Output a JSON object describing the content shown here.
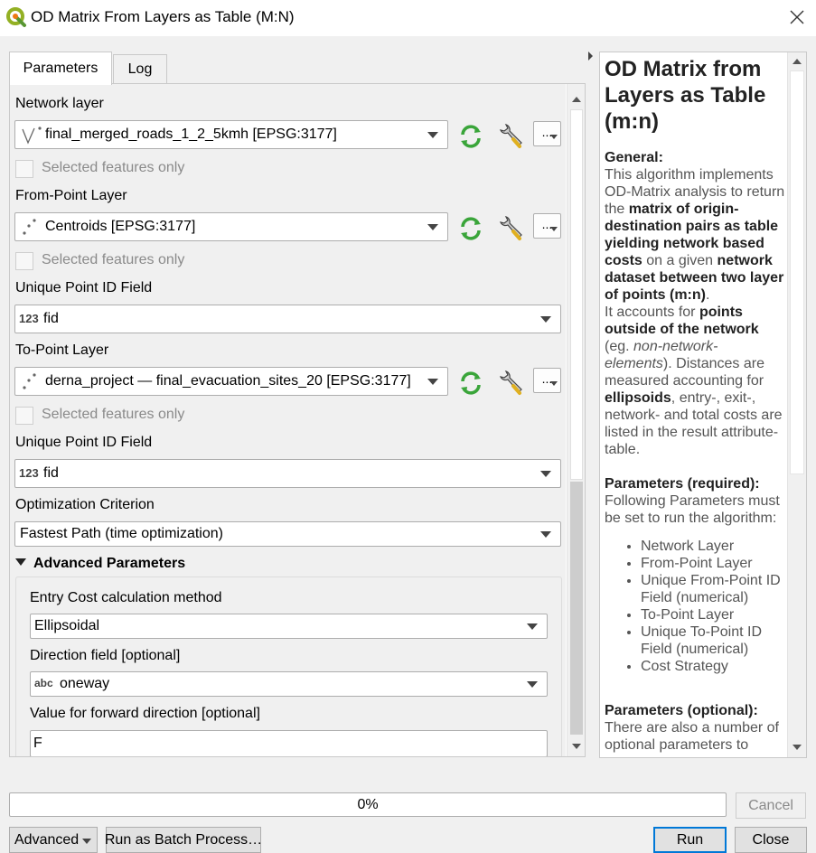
{
  "window": {
    "title": "OD Matrix From Layers as Table (M:N)"
  },
  "tabs": [
    {
      "label": "Parameters"
    },
    {
      "label": "Log"
    }
  ],
  "form": {
    "network_layer": {
      "label": "Network layer",
      "value": "final_merged_roads_1_2_5kmh [EPSG:3177]",
      "selected_only_label": "Selected features only",
      "selected_only_checked": false
    },
    "from_point_layer": {
      "label": "From-Point Layer",
      "value": "Centroids [EPSG:3177]",
      "selected_only_label": "Selected features only",
      "selected_only_checked": false
    },
    "from_id_field": {
      "label": "Unique Point ID Field",
      "type_icon": "123",
      "value": "fid"
    },
    "to_point_layer": {
      "label": "To-Point Layer",
      "value": "derna_project — final_evacuation_sites_20 [EPSG:3177]",
      "selected_only_label": "Selected features only",
      "selected_only_checked": false
    },
    "to_id_field": {
      "label": "Unique Point ID Field",
      "type_icon": "123",
      "value": "fid"
    },
    "optimization": {
      "label": "Optimization Criterion",
      "value": "Fastest Path (time optimization)"
    },
    "advanced": {
      "header": "Advanced Parameters",
      "entry_cost": {
        "label": "Entry Cost calculation method",
        "value": "Ellipsoidal"
      },
      "direction_field": {
        "label": "Direction field [optional]",
        "type_icon": "abc",
        "value": "oneway"
      },
      "forward_value": {
        "label": "Value for forward direction [optional]",
        "value": "F"
      }
    },
    "dots_label": "..."
  },
  "help": {
    "title": "OD Matrix from Layers as Table (m:n)",
    "general_heading": "General:",
    "p1_a": "This algorithm implements OD-Matrix analysis to return the ",
    "p1_b": "matrix of origin-destination pairs as table yielding network based costs",
    "p1_c": " on a given ",
    "p1_d": "network dataset between two layer of points (m:n)",
    "p1_e": ".",
    "p2_a": "It accounts for ",
    "p2_b": "points outside of the network",
    "p2_c": " (eg. ",
    "p2_d": "non-network-elements",
    "p2_e": "). Distances are measured accounting for ",
    "p2_f": "ellipsoids",
    "p2_g": ", entry-, exit-, network- and total costs are listed in the result attribute-table.",
    "req_heading": "Parameters (required):",
    "req_text": "Following Parameters must be set to run the algorithm:",
    "req_items": [
      "Network Layer",
      "From-Point Layer",
      "Unique From-Point ID Field (numerical)",
      "To-Point Layer",
      "Unique To-Point ID Field (numerical)",
      "Cost Strategy"
    ],
    "opt_heading": "Parameters (optional):",
    "opt_text": "There are also a number of optional parameters to"
  },
  "footer": {
    "progress_text": "0%",
    "progress_value": 0,
    "cancel_label": "Cancel",
    "advanced_label": "Advanced",
    "batch_label": "Run as Batch Process…",
    "run_label": "Run",
    "close_label": "Close"
  },
  "colors": {
    "qgis_green": "#589632",
    "refresh_green": "#3aa53a",
    "accent_blue": "#0078d7"
  }
}
